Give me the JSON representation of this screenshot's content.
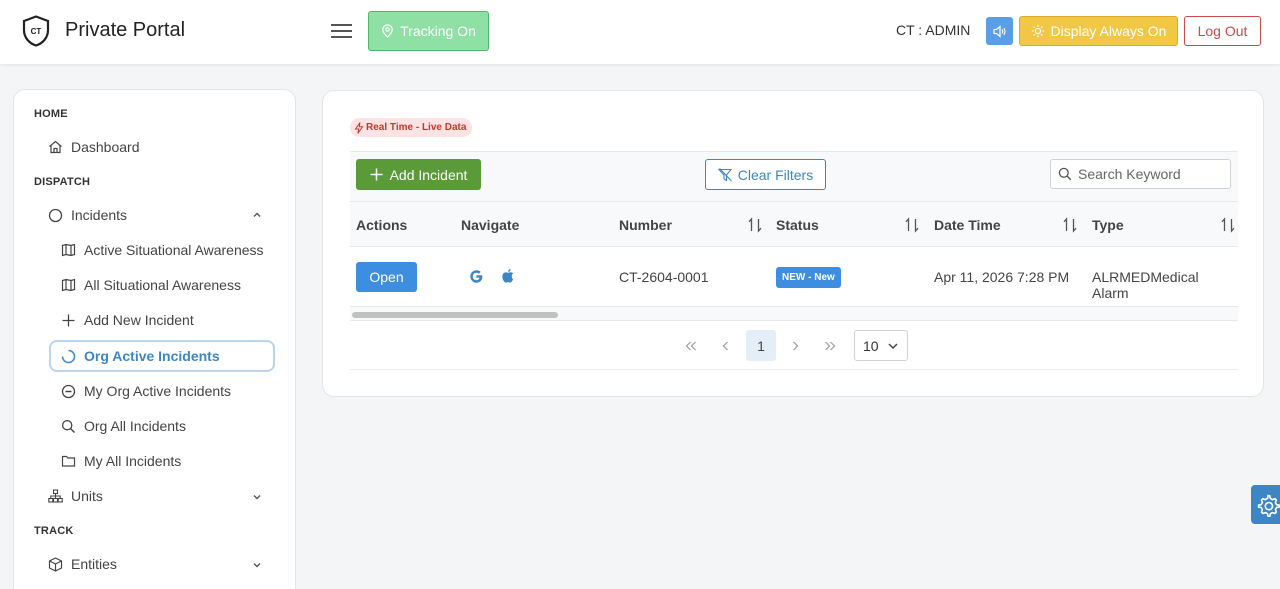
{
  "header": {
    "logo_text": "CT",
    "brand": "Private Portal",
    "tracking_label": "Tracking On",
    "user_label": "CT : ADMIN",
    "display_label": "Display Always On",
    "logout_label": "Log Out"
  },
  "sidebar": {
    "sections": {
      "home": "HOME",
      "dispatch": "DISPATCH",
      "track": "TRACK"
    },
    "items": {
      "dashboard": "Dashboard",
      "incidents": "Incidents",
      "active_sa": "Active Situational Awareness",
      "all_sa": "All Situational Awareness",
      "add_new": "Add New Incident",
      "org_active": "Org Active Incidents",
      "my_org_active": "My Org Active Incidents",
      "org_all": "Org All Incidents",
      "my_all": "My All Incidents",
      "units": "Units",
      "entities": "Entities"
    }
  },
  "main": {
    "live_badge": "Real Time - Live Data",
    "add_label": "Add Incident",
    "clear_label": "Clear Filters",
    "search_placeholder": "Search Keyword",
    "columns": {
      "actions": "Actions",
      "navigate": "Navigate",
      "number": "Number",
      "status": "Status",
      "datetime": "Date Time",
      "type": "Type"
    },
    "rows": [
      {
        "action": "Open",
        "number": "CT-2604-0001",
        "status": "NEW - New",
        "datetime": "Apr 11, 2026 7:28 PM",
        "type": "ALRMEDMedical Alarm"
      }
    ],
    "pagination": {
      "current_page": "1",
      "page_size": "10"
    }
  },
  "colors": {
    "primary": "#3d86c6",
    "success": "#5a9a38",
    "warning": "#f2c744",
    "danger": "#c94c4c",
    "tracking": "#8ee0a4"
  },
  "icons": [
    "shield-logo-icon",
    "hamburger-icon",
    "map-pin-icon",
    "speaker-icon",
    "sun-icon",
    "home-icon",
    "circle-icon",
    "map-icon",
    "plus-icon",
    "spinner-icon",
    "minus-circle-icon",
    "search-icon",
    "folder-icon",
    "sitemap-icon",
    "box-icon",
    "chevron-up-icon",
    "chevron-down-icon",
    "lightning-icon",
    "filter-icon",
    "sort-icon",
    "google-icon",
    "apple-icon",
    "first-page-icon",
    "prev-page-icon",
    "next-page-icon",
    "last-page-icon",
    "gear-icon"
  ]
}
